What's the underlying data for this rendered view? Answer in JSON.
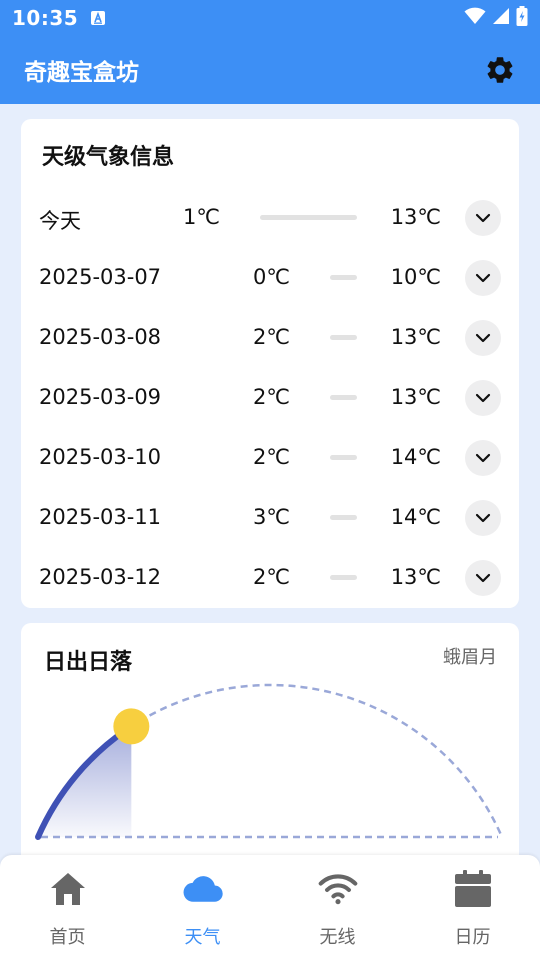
{
  "status": {
    "time": "10:35"
  },
  "app": {
    "title": "奇趣宝盒坊"
  },
  "forecast": {
    "title": "天级气象信息",
    "days": [
      {
        "date": "今天",
        "low": "1℃",
        "high": "13℃"
      },
      {
        "date": "2025-03-07",
        "low": "0℃",
        "high": "10℃"
      },
      {
        "date": "2025-03-08",
        "low": "2℃",
        "high": "13℃"
      },
      {
        "date": "2025-03-09",
        "low": "2℃",
        "high": "13℃"
      },
      {
        "date": "2025-03-10",
        "low": "2℃",
        "high": "14℃"
      },
      {
        "date": "2025-03-11",
        "low": "3℃",
        "high": "14℃"
      },
      {
        "date": "2025-03-12",
        "low": "2℃",
        "high": "13℃"
      }
    ]
  },
  "sun": {
    "title": "日出日落",
    "moon_phase": "蛾眉月",
    "progress": 0.25,
    "colors": {
      "arc": "#3f51b5",
      "sun": "#f7cf3f",
      "path": "#9aa8d8"
    }
  },
  "nav": {
    "items": [
      {
        "label": "首页"
      },
      {
        "label": "天气"
      },
      {
        "label": "无线"
      },
      {
        "label": "日历"
      }
    ],
    "active": 1,
    "colors": {
      "active": "#3d8ff5",
      "inactive": "#666666"
    }
  }
}
